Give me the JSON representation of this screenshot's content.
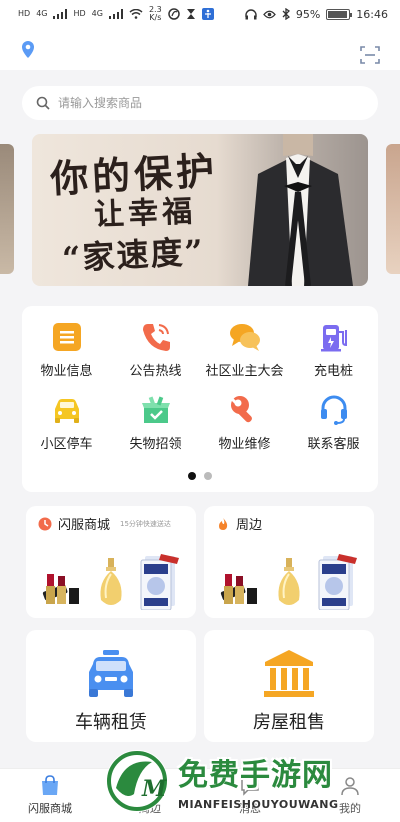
{
  "status_bar": {
    "hd_1": "HD",
    "net_1": "4G",
    "hd_2": "HD",
    "net_2": "4G",
    "speed_value": "2.3",
    "speed_unit": "K/s",
    "battery_text": "95%",
    "battery_level": 0.95,
    "time": "16:46"
  },
  "search": {
    "placeholder": "请输入搜索商品"
  },
  "banner": {
    "line1": "你的保护",
    "line2": "让幸福",
    "line3": "“家速度”"
  },
  "menu": {
    "items": [
      {
        "label": "物业信息",
        "icon": "document-icon",
        "color": "#f5a623"
      },
      {
        "label": "公告热线",
        "icon": "phone-icon",
        "color": "#f26b4b"
      },
      {
        "label": "社区业主大会",
        "icon": "chat-bubbles-icon",
        "color": "#f5a623"
      },
      {
        "label": "充电桩",
        "icon": "charging-station-icon",
        "color": "#7b6cf0"
      },
      {
        "label": "小区停车",
        "icon": "car-icon",
        "color": "#f5c623"
      },
      {
        "label": "失物招领",
        "icon": "lost-box-icon",
        "color": "#4cc98a"
      },
      {
        "label": "物业维修",
        "icon": "wrench-icon",
        "color": "#f26b4b"
      },
      {
        "label": "联系客服",
        "icon": "headset-icon",
        "color": "#3d8cf0"
      }
    ],
    "page_count": 2,
    "active_page": 1
  },
  "shops": {
    "flash": {
      "title": "闪服商城",
      "subtitle": "15分钟快速送达",
      "icon": "flash-clock-icon"
    },
    "nearby": {
      "title": "周边",
      "icon": "flame-icon"
    }
  },
  "rentals": {
    "car": {
      "label": "车辆租赁",
      "icon": "car-front-icon",
      "color": "#4a8ff0"
    },
    "house": {
      "label": "房屋租售",
      "icon": "building-icon",
      "color": "#f5a623"
    }
  },
  "bottom_nav": {
    "items": [
      {
        "label": "闪服商城",
        "icon": "shopping-bag-icon",
        "active": true
      },
      {
        "label": "周边",
        "icon": "map-icon",
        "active": false
      },
      {
        "label": "消息",
        "icon": "message-icon",
        "active": false
      },
      {
        "label": "我的",
        "icon": "user-icon",
        "active": false
      }
    ]
  },
  "watermark": {
    "title": "免费手游网",
    "subtitle": "MIANFEISHOUYOUWANG",
    "logo_letter": "M"
  },
  "colors": {
    "accent_red": "#f26b4b",
    "accent_orange": "#f5a623",
    "accent_blue": "#4a8ff0",
    "watermark_green": "#2b8a3e"
  }
}
